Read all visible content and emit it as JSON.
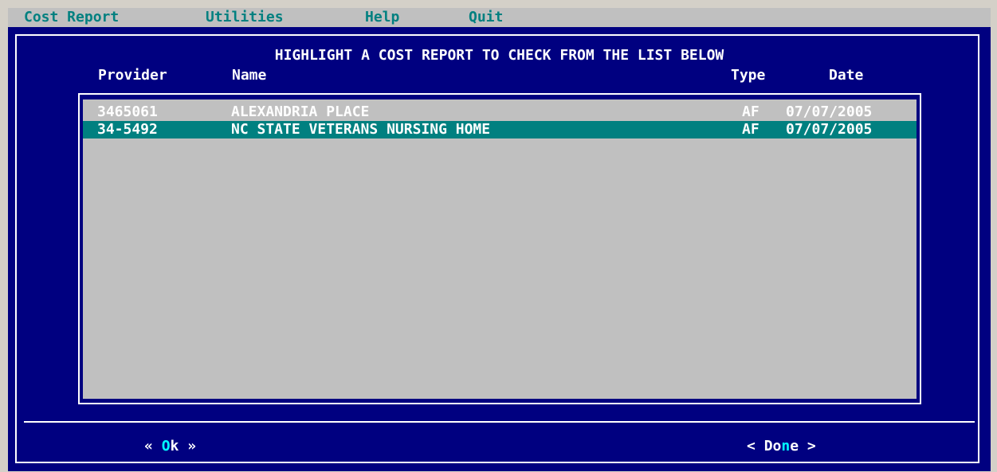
{
  "menu": {
    "items": [
      {
        "label": "Cost Report"
      },
      {
        "label": "Utilities"
      },
      {
        "label": "Help"
      },
      {
        "label": "Quit"
      }
    ]
  },
  "dialog": {
    "title": "HIGHLIGHT A COST REPORT TO CHECK FROM THE LIST BELOW",
    "columns": {
      "provider": "Provider",
      "name": "Name",
      "type": "Type",
      "date": "Date"
    }
  },
  "list": {
    "selected_index": 1,
    "rows": [
      {
        "provider": "3465061",
        "name": "ALEXANDRIA PLACE",
        "type": "AF",
        "date": "07/07/2005"
      },
      {
        "provider": "34-5492",
        "name": "NC STATE VETERANS NURSING HOME",
        "type": "AF",
        "date": "07/07/2005"
      }
    ]
  },
  "buttons": {
    "ok": {
      "prefix": "« ",
      "hotkey": "O",
      "rest": "k",
      "suffix": " »"
    },
    "done": {
      "prefix": "< ",
      "before": "Do",
      "hotkey": "n",
      "after": "e",
      "suffix": " >"
    }
  },
  "colors": {
    "background": "#000080",
    "menubar": "#c0c0c0",
    "menu_text": "#008080",
    "list_background": "#c0c0c0",
    "selection": "#008080",
    "hotkey": "#00ffff"
  }
}
